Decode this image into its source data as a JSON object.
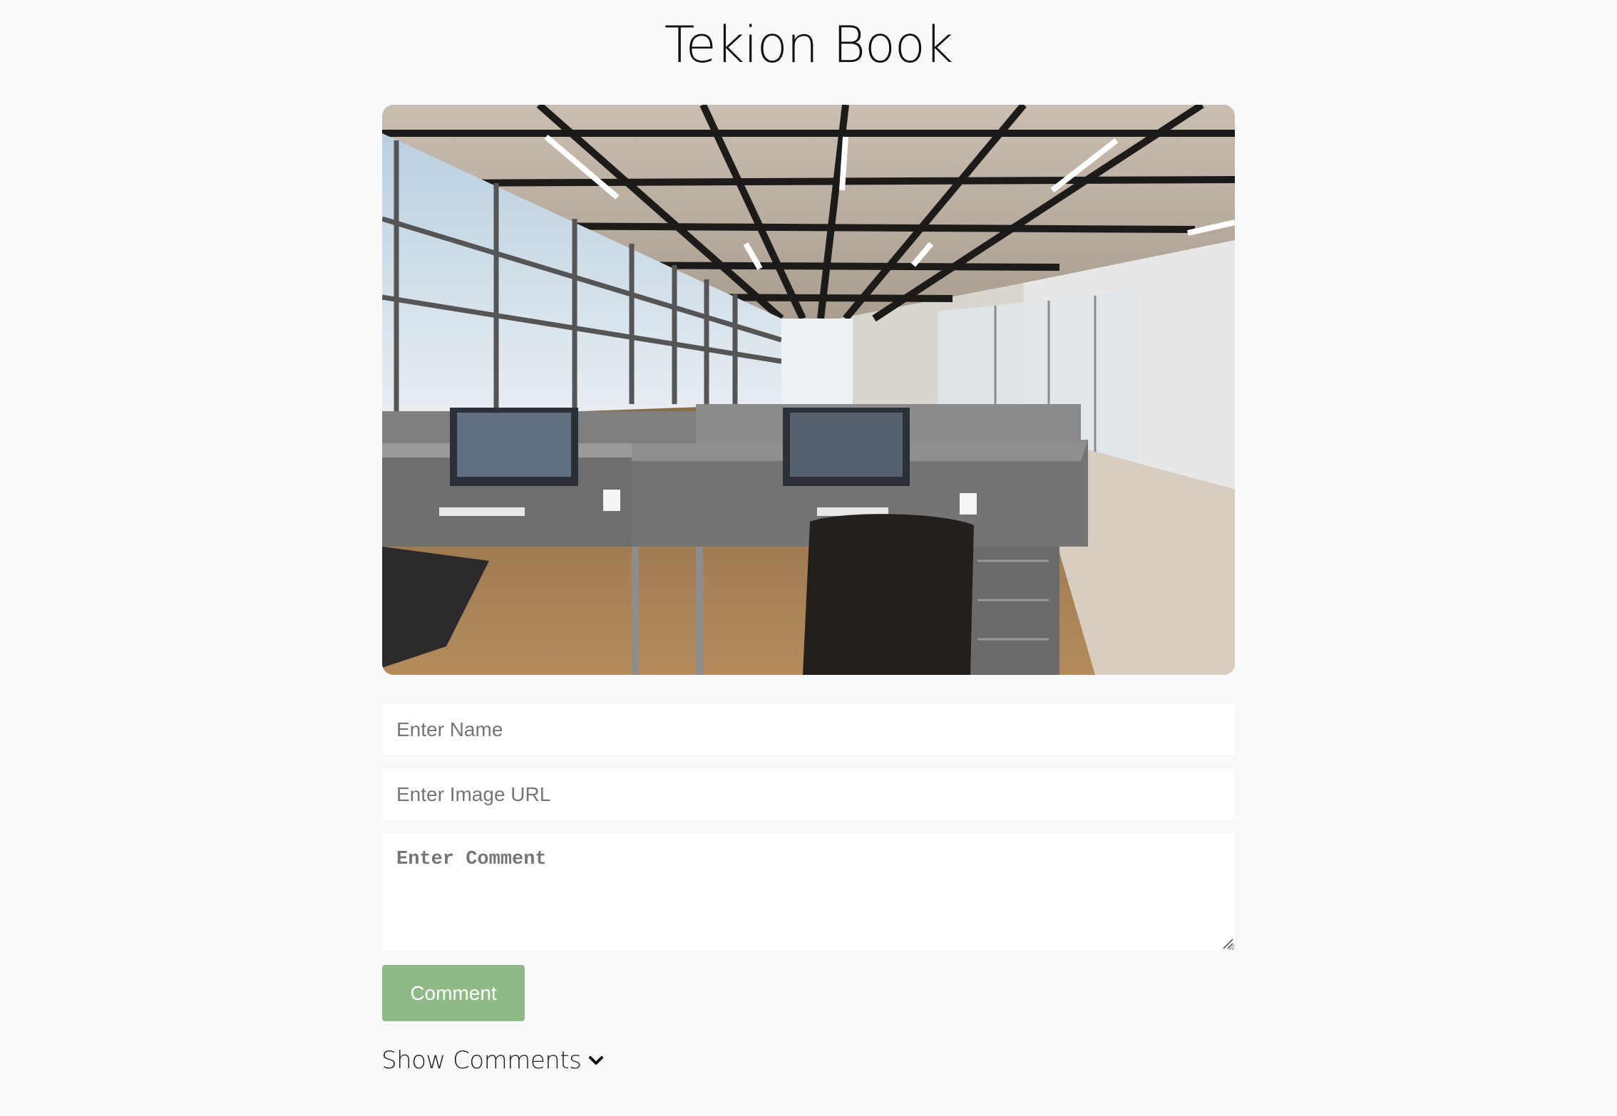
{
  "page": {
    "title": "Tekion Book"
  },
  "hero_image": {
    "description_icon": "office-photo"
  },
  "form": {
    "name_placeholder": "Enter Name",
    "url_placeholder": "Enter Image URL",
    "comment_placeholder": "Enter Comment",
    "submit_label": "Comment"
  },
  "comments_toggle": {
    "label": "Show Comments",
    "icon": "chevron-down-icon"
  },
  "colors": {
    "background": "#f8f9fa",
    "button": "#8fb986",
    "button_text": "#ffffff"
  }
}
